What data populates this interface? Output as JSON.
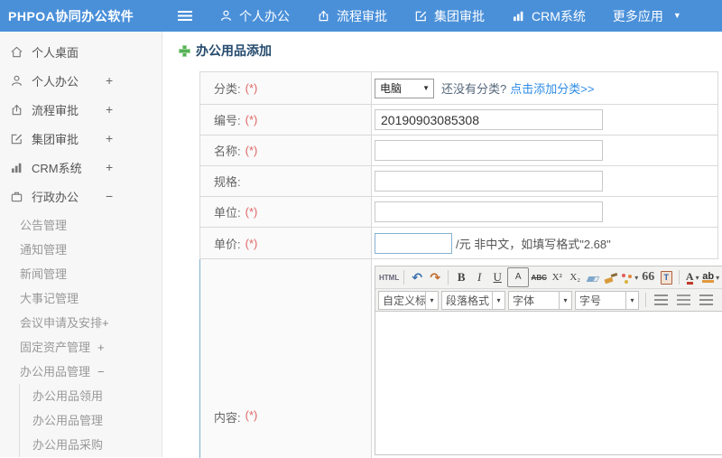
{
  "header": {
    "logo": "PHPOA协同办公软件",
    "nav": [
      {
        "label": "个人办公"
      },
      {
        "label": "流程审批"
      },
      {
        "label": "集团审批"
      },
      {
        "label": "CRM系统"
      },
      {
        "label": "更多应用"
      }
    ]
  },
  "icons": {
    "caret_down": "▼",
    "select_caret": "▼",
    "dropdown_caret": "▾",
    "link_infinity": "∞"
  },
  "sidebar": {
    "items": [
      {
        "label": "个人桌面",
        "expand": ""
      },
      {
        "label": "个人办公",
        "expand": "+"
      },
      {
        "label": "流程审批",
        "expand": "+"
      },
      {
        "label": "集团审批",
        "expand": "+"
      },
      {
        "label": "CRM系统",
        "expand": "+"
      },
      {
        "label": "行政办公",
        "expand": "−"
      }
    ],
    "admin_children": [
      {
        "label": "公告管理",
        "expand": ""
      },
      {
        "label": "通知管理",
        "expand": ""
      },
      {
        "label": "新闻管理",
        "expand": ""
      },
      {
        "label": "大事记管理",
        "expand": ""
      },
      {
        "label": "会议申请及安排",
        "expand": "+"
      },
      {
        "label": "固定资产管理",
        "expand": "+"
      },
      {
        "label": "办公用品管理",
        "expand": "−"
      }
    ],
    "supplies_children": [
      {
        "label": "办公用品领用"
      },
      {
        "label": "办公用品管理"
      },
      {
        "label": "办公用品采购"
      }
    ]
  },
  "main": {
    "page_title": "办公用品添加",
    "form": {
      "category": {
        "label": "分类:",
        "required": "(*)",
        "select_value": "电脑",
        "hint": "还没有分类?",
        "add_link": "点击添加分类>>"
      },
      "code": {
        "label": "编号:",
        "required": "(*)",
        "value": "20190903085308"
      },
      "name": {
        "label": "名称:",
        "required": "(*)"
      },
      "spec": {
        "label": "规格:"
      },
      "unit": {
        "label": "单位:",
        "required": "(*)"
      },
      "price": {
        "label": "单价:",
        "required": "(*)",
        "suffix": "/元 非中文，如填写格式\"2.68\""
      },
      "content": {
        "label": "内容:",
        "required": "(*)"
      }
    },
    "editor": {
      "html_button": "HTML",
      "undo": "↶",
      "redo": "↷",
      "bold": "B",
      "italic": "I",
      "underline": "U",
      "font_border": "A",
      "strikethrough": "ABC",
      "superscript": "X²",
      "subscript": "X₂",
      "quote": "66",
      "font_color": "A",
      "highlight": "ab",
      "selects": [
        {
          "label": "自定义标题"
        },
        {
          "label": "段落格式"
        },
        {
          "label": "字体"
        },
        {
          "label": "字号"
        }
      ]
    }
  },
  "colors": {
    "header_bg": "#4a90d9",
    "sidebar_bg": "#f7f7f7",
    "link": "#2e8ce6",
    "required": "#e06666",
    "title_text": "#254a6d",
    "content_row_border": "#7fb0d0"
  }
}
